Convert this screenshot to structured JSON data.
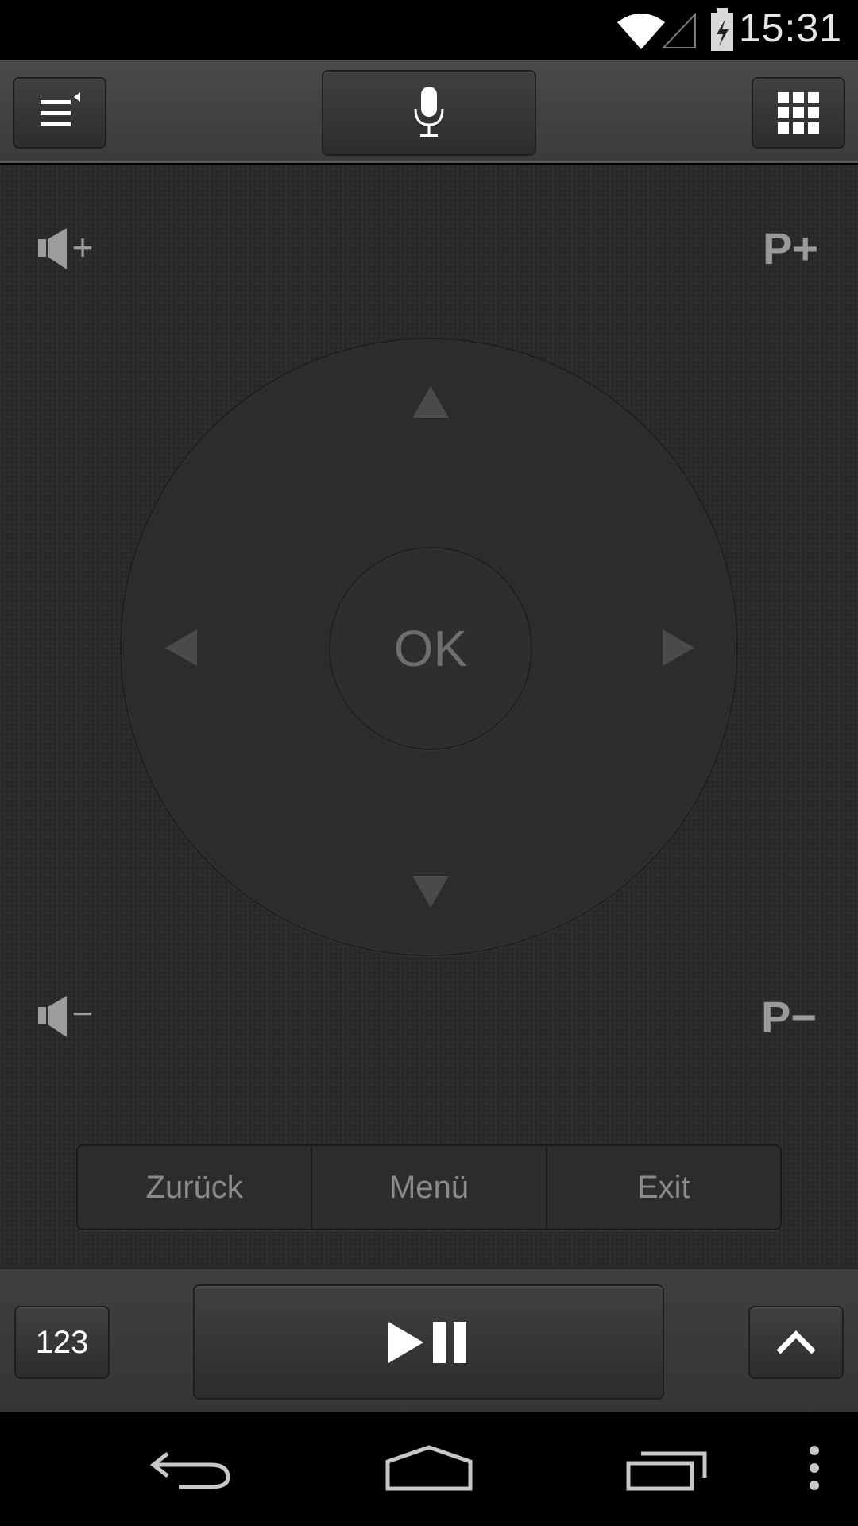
{
  "status_bar": {
    "time": "15:31",
    "icons": [
      "wifi-icon",
      "cell-signal-icon",
      "battery-charging-icon"
    ]
  },
  "top_toolbar": {
    "left_icon": "menu-list-icon",
    "center_icon": "microphone-icon",
    "right_icon": "keypad-grid-icon"
  },
  "remote": {
    "volume_up_symbol": "+",
    "volume_down_symbol": "−",
    "program_up": "P+",
    "program_down": "P−",
    "ok_label": "OK"
  },
  "segments": [
    {
      "label": "Zurück"
    },
    {
      "label": "Menü"
    },
    {
      "label": "Exit"
    }
  ],
  "bottom_toolbar": {
    "numbers_label": "123",
    "play_icon": "play-pause-icon",
    "expand_icon": "chevron-up-icon"
  },
  "nav_bar": {
    "icons": [
      "back-icon",
      "home-icon",
      "recent-apps-icon",
      "overflow-menu-icon"
    ]
  },
  "colors": {
    "background": "#2a2a2a",
    "toolbar": "#3f3f3f",
    "label": "#9a9a9a"
  }
}
